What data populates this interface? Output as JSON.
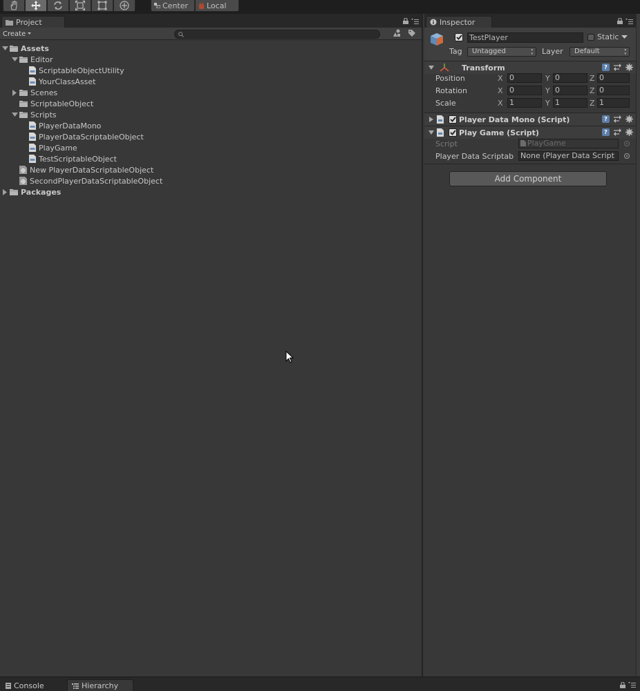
{
  "toolbar": {
    "tools": [
      "hand-tool",
      "move-tool",
      "rotate-tool",
      "scale-tool",
      "rect-tool",
      "transform-tool"
    ],
    "active_tool": "move-tool",
    "pivot_label": "Center",
    "space_label": "Local"
  },
  "project": {
    "tab_label": "Project",
    "create_label": "Create",
    "tree": [
      {
        "label": "Assets",
        "kind": "folder",
        "depth": 0,
        "expanded": true,
        "bold": true
      },
      {
        "label": "Editor",
        "kind": "folder",
        "depth": 1,
        "expanded": true
      },
      {
        "label": "ScriptableObjectUtility",
        "kind": "script",
        "depth": 2
      },
      {
        "label": "YourClassAsset",
        "kind": "script",
        "depth": 2
      },
      {
        "label": "Scenes",
        "kind": "folder",
        "depth": 1,
        "expanded": false
      },
      {
        "label": "ScriptableObject",
        "kind": "folder",
        "depth": 1,
        "leaf": true
      },
      {
        "label": "Scripts",
        "kind": "folder",
        "depth": 1,
        "expanded": true
      },
      {
        "label": "PlayerDataMono",
        "kind": "script",
        "depth": 2
      },
      {
        "label": "PlayerDataScriptableObject",
        "kind": "script",
        "depth": 2
      },
      {
        "label": "PlayGame",
        "kind": "script",
        "depth": 2
      },
      {
        "label": "TestScriptableObject",
        "kind": "script",
        "depth": 2
      },
      {
        "label": "New PlayerDataScriptableObject",
        "kind": "asset",
        "depth": 1
      },
      {
        "label": "SecondPlayerDataScriptableObject",
        "kind": "asset",
        "depth": 1
      },
      {
        "label": "Packages",
        "kind": "folder",
        "depth": 0,
        "expanded": false,
        "bold": true
      }
    ]
  },
  "inspector": {
    "tab_label": "Inspector",
    "object_name": "TestPlayer",
    "active": true,
    "static_label": "Static",
    "static_checked": false,
    "tag_label": "Tag",
    "tag_value": "Untagged",
    "layer_label": "Layer",
    "layer_value": "Default",
    "transform": {
      "title": "Transform",
      "rows": [
        {
          "label": "Position",
          "x": "0",
          "y": "0",
          "z": "0"
        },
        {
          "label": "Rotation",
          "x": "0",
          "y": "0",
          "z": "0"
        },
        {
          "label": "Scale",
          "x": "1",
          "y": "1",
          "z": "1"
        }
      ],
      "axis_x": "X",
      "axis_y": "Y",
      "axis_z": "Z"
    },
    "components": [
      {
        "title": "Player Data Mono (Script)",
        "expanded": false,
        "enabled": true
      },
      {
        "title": "Play Game (Script)",
        "expanded": true,
        "enabled": true
      }
    ],
    "play_game": {
      "script_label": "Script",
      "script_value": "PlayGame",
      "field_label": "Player Data Scriptab",
      "field_value": "None (Player Data Script"
    },
    "add_component_label": "Add Component"
  },
  "bottom_tabs": [
    {
      "label": "Console",
      "active": false
    },
    {
      "label": "Hierarchy",
      "active": true
    }
  ],
  "colors": {
    "background": "#383838",
    "panel_dark": "#282828",
    "text": "#c8c8c8",
    "field": "#2c2c2c",
    "folder": "#b5b5b5",
    "script_icon": "#8aa8c8"
  }
}
